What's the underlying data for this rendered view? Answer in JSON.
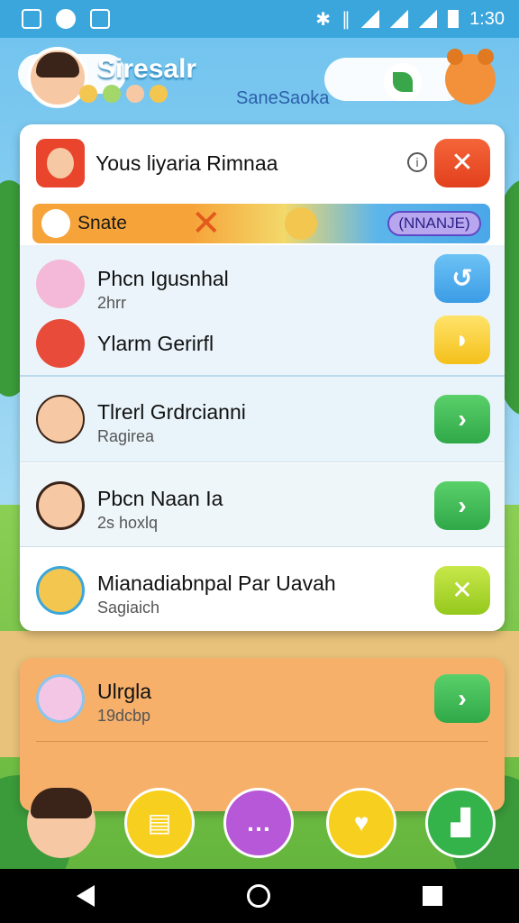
{
  "status_bar": {
    "time": "1:30",
    "left_icons": [
      "app-icon",
      "whatsapp-icon",
      "sd-icon"
    ],
    "right_icons": [
      "bluetooth-icon",
      "vibrate-icon",
      "wifi-icon",
      "signal-icon",
      "signal-icon",
      "battery-icon"
    ]
  },
  "header": {
    "app_title": "Siresalr",
    "subtitle": "SaneSaoka"
  },
  "card": {
    "title": "Yous liyaria Rimnaa",
    "close_label": "✕",
    "banner": {
      "label": "Snate",
      "pill": "(NNANJE)"
    },
    "rows": [
      {
        "name": "Phcn Igusnhal",
        "sub": "2hrr",
        "action": "↺"
      },
      {
        "name": "Ylarm Gerirfl",
        "sub": "",
        "action": "◗"
      },
      {
        "name": "Tlrerl Grdrcianni",
        "sub": "Ragirea",
        "action": "›"
      },
      {
        "name": "Pbcn Naan Ia",
        "sub": "2s hoxlq",
        "action": "›"
      },
      {
        "name": "Mianadiabnpal Par Uavah",
        "sub": "Sagiaich",
        "action": "✕"
      }
    ]
  },
  "card2": {
    "name": "Ulrgla",
    "sub": "19dcbp",
    "action": "›"
  },
  "bottom_bar": {
    "buttons": [
      "calendar-icon",
      "chat-icon",
      "heart-icon",
      "puzzle-icon"
    ]
  },
  "nav": {
    "back": "back",
    "home": "home",
    "recent": "recent"
  }
}
